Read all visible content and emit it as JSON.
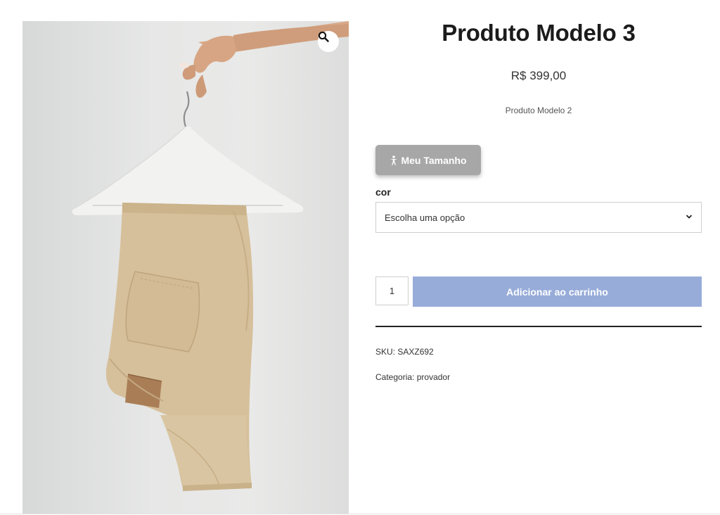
{
  "product": {
    "title": "Produto Modelo 3",
    "price": "R$ 399,00",
    "short_description": "Produto Modelo 2",
    "image_icon": "zoom-icon"
  },
  "size_button": {
    "label": "Meu Tamanho",
    "icon": "person-icon"
  },
  "variation": {
    "label": "cor",
    "selected": "Escolha uma opção"
  },
  "cart": {
    "quantity": "1",
    "add_label": "Adicionar ao carrinho",
    "button_color": "#97acd9"
  },
  "meta": {
    "sku_label": "SKU:",
    "sku_value": "SAXZ692",
    "category_label": "Categoria:",
    "category_value": "provador"
  }
}
